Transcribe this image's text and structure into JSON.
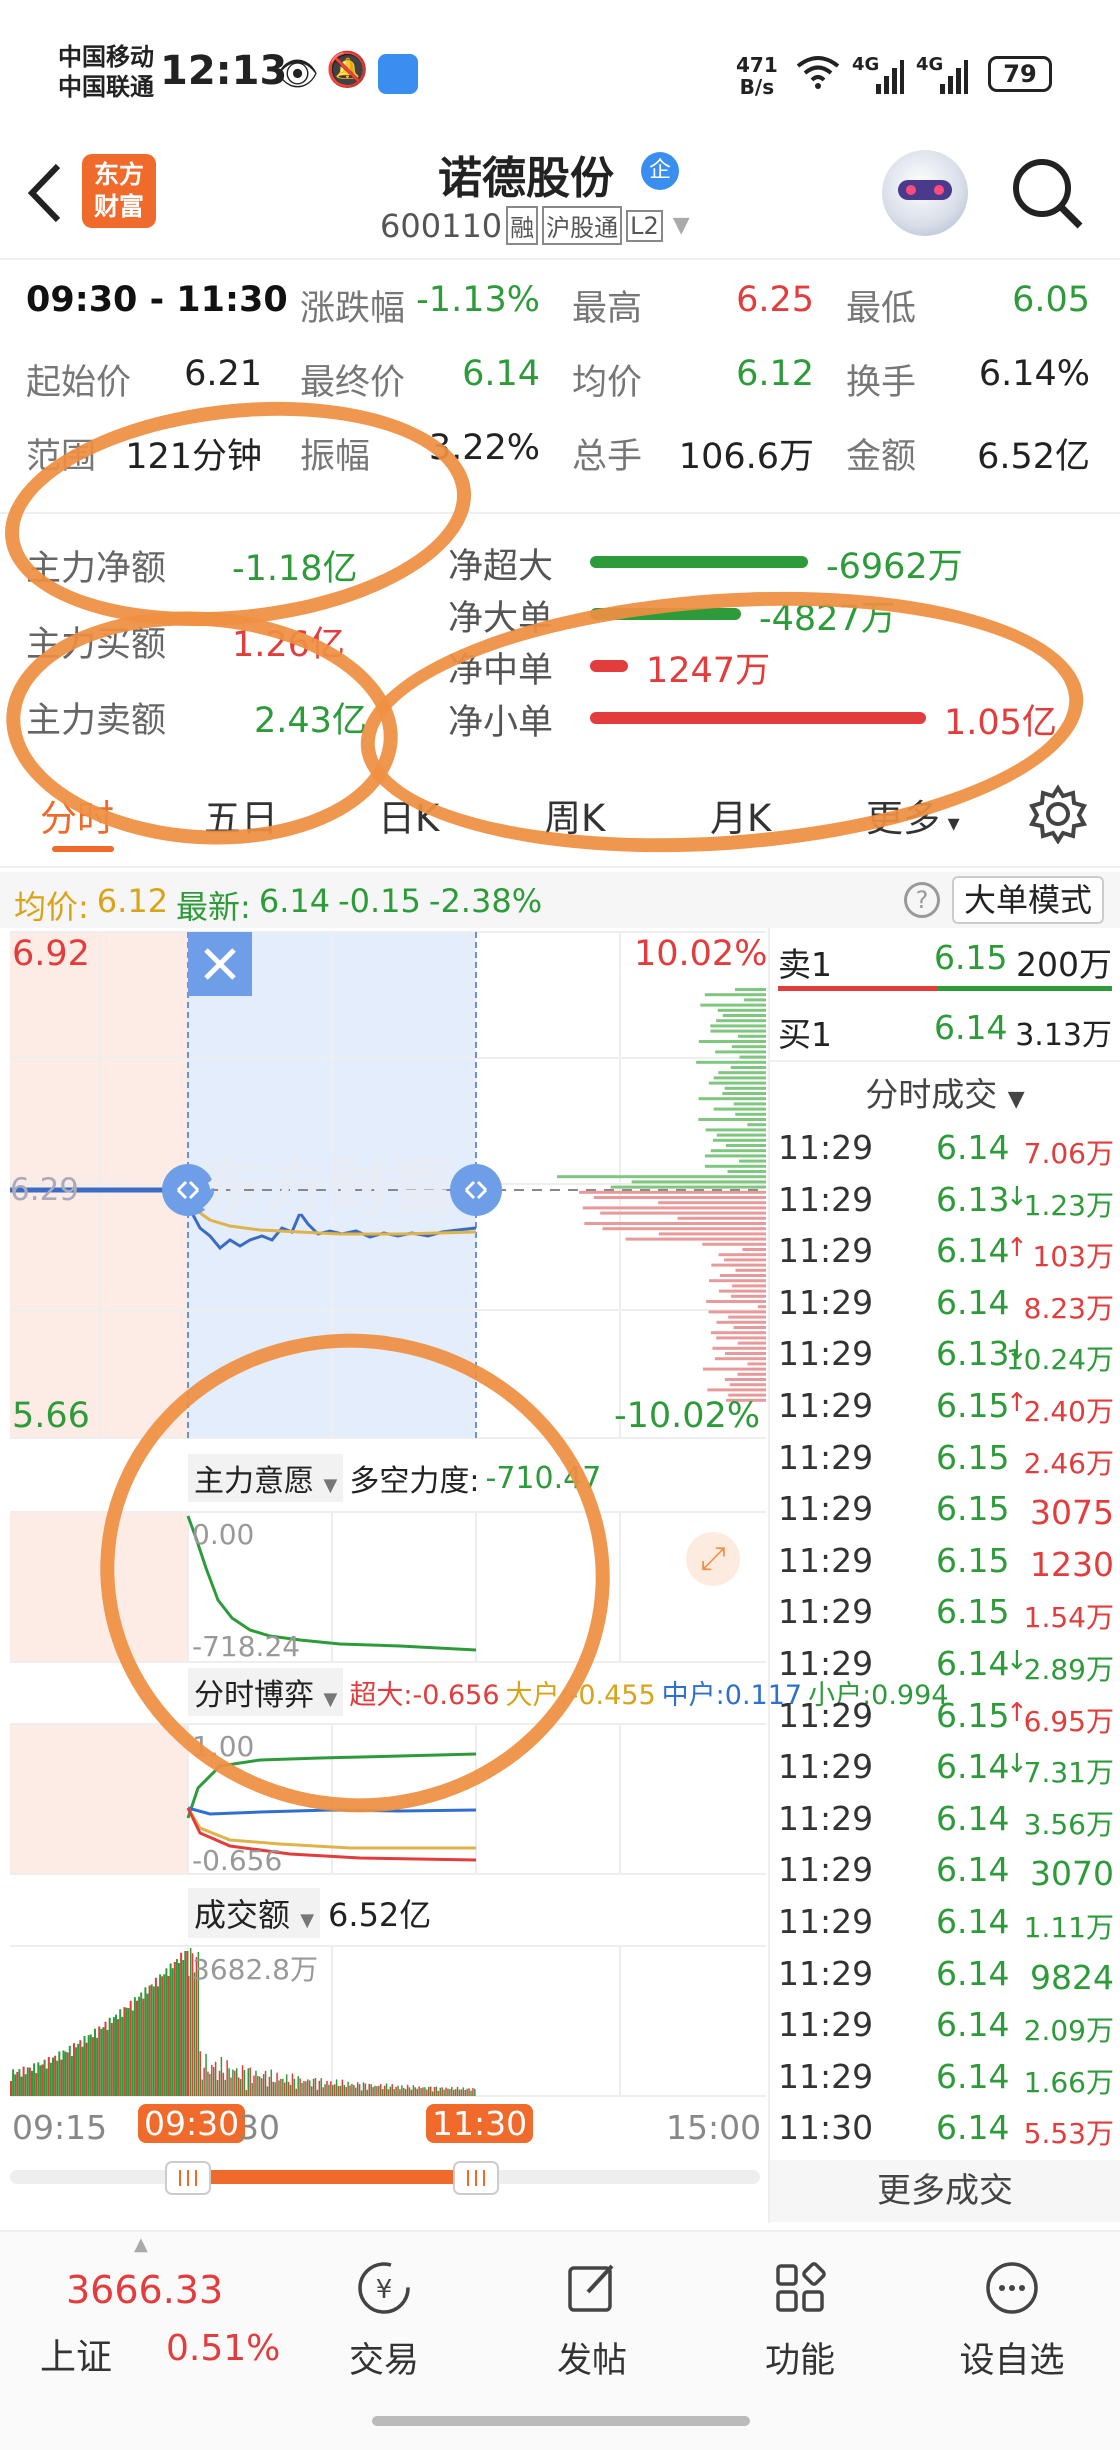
{
  "status_bar": {
    "carrier1": "中国移动",
    "carrier2": "中国联通",
    "time": "12:13",
    "net_speed_value": "471",
    "net_speed_unit": "B/s",
    "signal1": "4G",
    "signal2": "4G",
    "battery": "79"
  },
  "header": {
    "logo_line1": "东方",
    "logo_line2": "财富",
    "stock_name": "诺德股份",
    "name_badge": "企",
    "code": "600110",
    "tag1": "融",
    "tag2": "沪股通",
    "tag3": "L2"
  },
  "stats": {
    "row1": [
      {
        "label": "09:30 - 11:30",
        "value": ""
      },
      {
        "label": "涨跌幅",
        "value": "-1.13%"
      },
      {
        "label": "最高",
        "value": "6.25"
      },
      {
        "label": "最低",
        "value": "6.05"
      }
    ],
    "row2": [
      {
        "label": "起始价",
        "value": "6.21"
      },
      {
        "label": "最终价",
        "value": "6.14"
      },
      {
        "label": "均价",
        "value": "6.12"
      },
      {
        "label": "换手",
        "value": "6.14%"
      }
    ],
    "row3": [
      {
        "label": "范围",
        "value": "121分钟"
      },
      {
        "label": "振幅",
        "value": "3.22%"
      },
      {
        "label": "总手",
        "value": "106.6万"
      },
      {
        "label": "金额",
        "value": "6.52亿"
      }
    ]
  },
  "capital": {
    "main_net_label": "主力净额",
    "main_net_value": "-1.18亿",
    "main_buy_label": "主力买额",
    "main_buy_value": "1.26亿",
    "main_sell_label": "主力卖额",
    "main_sell_value": "2.43亿",
    "flows": [
      {
        "label": "净超大",
        "value": "-6962万",
        "level": 0.52,
        "color": "#2e9b3a"
      },
      {
        "label": "净大单",
        "value": "-4827万",
        "level": 0.36,
        "color": "#2e9b3a"
      },
      {
        "label": "净中单",
        "value": "1247万",
        "level": 0.09,
        "color": "#e23c3c"
      },
      {
        "label": "净小单",
        "value": "1.05亿",
        "level": 0.8,
        "color": "#e23c3c"
      }
    ]
  },
  "tabs": [
    "分时",
    "五日",
    "日K",
    "周K",
    "月K",
    "更多"
  ],
  "infobar": {
    "avg_label": "均价:",
    "avg_value": "6.12",
    "latest_label": "最新:",
    "latest_value": "6.14",
    "change": "-0.15",
    "change_pct": "-2.38%",
    "mode_button": "大单模式"
  },
  "chart": {
    "price_high": "6.92",
    "price_low": "5.66",
    "pct_high": "10.02%",
    "pct_low": "-10.02%",
    "prev_close": "6.29",
    "watermark": "东方财富",
    "intent_label": "主力意愿",
    "intent_metric_label": "多空力度:",
    "intent_metric_value": "-710.47",
    "intent_top": "0.00",
    "intent_bottom": "-718.24",
    "game_label": "分时博弈",
    "game_super": "超大:-0.656",
    "game_big": "大户:-0.455",
    "game_mid": "中户:0.117",
    "game_small": "小户:0.994",
    "game_top": "1.00",
    "game_bottom": "-0.656",
    "amount_label": "成交额",
    "amount_value": "6.52亿",
    "amount_peak": "3682.8万",
    "time_start": "09:15",
    "time_range_start": "09:30",
    "time_partial": "30",
    "time_range_end": "11:30",
    "time_end": "15:00"
  },
  "orderbook": {
    "sell1_label": "卖1",
    "sell1_price": "6.15",
    "sell1_vol": "200万",
    "buy1_label": "买1",
    "buy1_price": "6.14",
    "buy1_vol": "3.13万"
  },
  "trades_title": "分时成交",
  "trades": [
    {
      "time": "11:29",
      "price": "6.14",
      "arrow": "",
      "vol": "7.06万",
      "pc": "#2e9b3a",
      "vc": "#e23c3c"
    },
    {
      "time": "11:29",
      "price": "6.13",
      "arrow": "↓",
      "vol": "1.23万",
      "pc": "#2e9b3a",
      "vc": "#2e9b3a"
    },
    {
      "time": "11:29",
      "price": "6.14",
      "arrow": "↑",
      "vol": "103万",
      "pc": "#2e9b3a",
      "vc": "#e23c3c"
    },
    {
      "time": "11:29",
      "price": "6.14",
      "arrow": "",
      "vol": "8.23万",
      "pc": "#2e9b3a",
      "vc": "#e23c3c"
    },
    {
      "time": "11:29",
      "price": "6.13",
      "arrow": "↓",
      "vol": "10.24万",
      "pc": "#2e9b3a",
      "vc": "#2e9b3a"
    },
    {
      "time": "11:29",
      "price": "6.15",
      "arrow": "↑",
      "vol": "2.40万",
      "pc": "#2e9b3a",
      "vc": "#e23c3c"
    },
    {
      "time": "11:29",
      "price": "6.15",
      "arrow": "",
      "vol": "2.46万",
      "pc": "#2e9b3a",
      "vc": "#e23c3c"
    },
    {
      "time": "11:29",
      "price": "6.15",
      "arrow": "",
      "vol": "3075",
      "pc": "#2e9b3a",
      "vc": "#e23c3c"
    },
    {
      "time": "11:29",
      "price": "6.15",
      "arrow": "",
      "vol": "1230",
      "pc": "#2e9b3a",
      "vc": "#e23c3c"
    },
    {
      "time": "11:29",
      "price": "6.15",
      "arrow": "",
      "vol": "1.54万",
      "pc": "#2e9b3a",
      "vc": "#e23c3c"
    },
    {
      "time": "11:29",
      "price": "6.14",
      "arrow": "↓",
      "vol": "2.89万",
      "pc": "#2e9b3a",
      "vc": "#2e9b3a"
    },
    {
      "time": "11:29",
      "price": "6.15",
      "arrow": "↑",
      "vol": "6.95万",
      "pc": "#2e9b3a",
      "vc": "#e23c3c"
    },
    {
      "time": "11:29",
      "price": "6.14",
      "arrow": "↓",
      "vol": "7.31万",
      "pc": "#2e9b3a",
      "vc": "#2e9b3a"
    },
    {
      "time": "11:29",
      "price": "6.14",
      "arrow": "",
      "vol": "3.56万",
      "pc": "#2e9b3a",
      "vc": "#2e9b3a"
    },
    {
      "time": "11:29",
      "price": "6.14",
      "arrow": "",
      "vol": "3070",
      "pc": "#2e9b3a",
      "vc": "#2e9b3a"
    },
    {
      "time": "11:29",
      "price": "6.14",
      "arrow": "",
      "vol": "1.11万",
      "pc": "#2e9b3a",
      "vc": "#2e9b3a"
    },
    {
      "time": "11:29",
      "price": "6.14",
      "arrow": "",
      "vol": "9824",
      "pc": "#2e9b3a",
      "vc": "#2e9b3a"
    },
    {
      "time": "11:29",
      "price": "6.14",
      "arrow": "",
      "vol": "2.09万",
      "pc": "#2e9b3a",
      "vc": "#2e9b3a"
    },
    {
      "time": "11:29",
      "price": "6.14",
      "arrow": "",
      "vol": "1.66万",
      "pc": "#2e9b3a",
      "vc": "#2e9b3a"
    },
    {
      "time": "11:30",
      "price": "6.14",
      "arrow": "",
      "vol": "5.53万",
      "pc": "#2e9b3a",
      "vc": "#e23c3c"
    }
  ],
  "more_trades": "更多成交",
  "bottom_nav": {
    "index_value": "3666.33",
    "index_name": "上证",
    "index_pct": "0.51%",
    "items": [
      "交易",
      "发帖",
      "功能",
      "设自选"
    ]
  },
  "colors": {
    "up": "#e23c3c",
    "down": "#2e9b3a",
    "accent": "#ef6a2b",
    "annotation": "#ef8f42"
  }
}
